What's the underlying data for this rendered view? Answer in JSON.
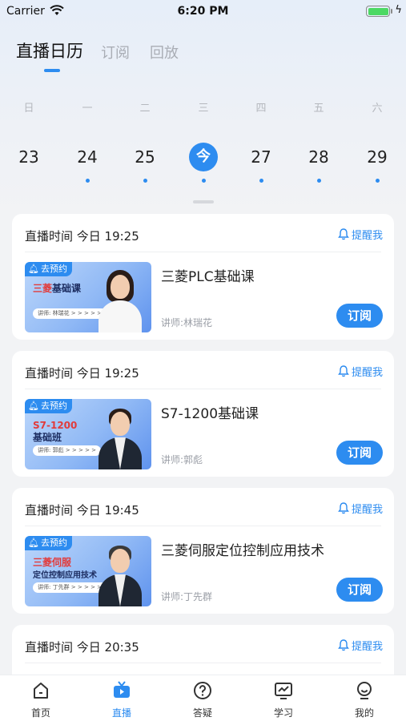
{
  "status_bar": {
    "carrier": "Carrier",
    "time": "6:20 PM",
    "battery_level": 1.0
  },
  "tabs": [
    {
      "label": "直播日历",
      "active": true
    },
    {
      "label": "订阅",
      "active": false
    },
    {
      "label": "回放",
      "active": false
    }
  ],
  "calendar": {
    "weekdays": [
      "日",
      "一",
      "二",
      "三",
      "四",
      "五",
      "六"
    ],
    "days": [
      {
        "label": "23",
        "has_event": false
      },
      {
        "label": "24",
        "has_event": true
      },
      {
        "label": "25",
        "has_event": true
      },
      {
        "label": "今",
        "has_event": true,
        "today": true
      },
      {
        "label": "27",
        "has_event": true
      },
      {
        "label": "28",
        "has_event": true
      },
      {
        "label": "29",
        "has_event": true
      }
    ]
  },
  "cards": [
    {
      "time": "直播时间 今日 19:25",
      "remind": "提醒我",
      "badge": "去预约",
      "thumb_title_red": "三菱",
      "thumb_title": "基础课",
      "thumb_lecturer": "讲师: 林瑞花 > > > > >",
      "title": "三菱PLC基础课",
      "lecturer": "讲师:林瑞花",
      "button": "订阅"
    },
    {
      "time": "直播时间 今日 19:25",
      "remind": "提醒我",
      "badge": "去预约",
      "thumb_title_red": "S7-1200",
      "thumb_title": "基础班",
      "thumb_lecturer": "讲师: 郭彪 > > > > >",
      "title": "S7-1200基础课",
      "lecturer": "讲师:郭彪",
      "button": "订阅"
    },
    {
      "time": "直播时间 今日 19:45",
      "remind": "提醒我",
      "badge": "去预约",
      "thumb_title_red": "三菱伺服",
      "thumb_title": "定位控制应用技术",
      "thumb_lecturer": "讲师: 丁先群 > > > > >",
      "title": "三菱伺服定位控制应用技术",
      "lecturer": "讲师:丁先群",
      "button": "订阅"
    },
    {
      "time": "直播时间 今日 20:35",
      "remind": "提醒我"
    }
  ],
  "bottom_nav": [
    {
      "label": "首页",
      "icon": "home-icon",
      "active": false
    },
    {
      "label": "直播",
      "icon": "tv-icon",
      "active": true
    },
    {
      "label": "答疑",
      "icon": "question-icon",
      "active": false
    },
    {
      "label": "学习",
      "icon": "study-chart-icon",
      "active": false
    },
    {
      "label": "我的",
      "icon": "profile-icon",
      "active": false
    }
  ],
  "colors": {
    "accent": "#2d8cf0",
    "background": "#f2f3f5"
  }
}
